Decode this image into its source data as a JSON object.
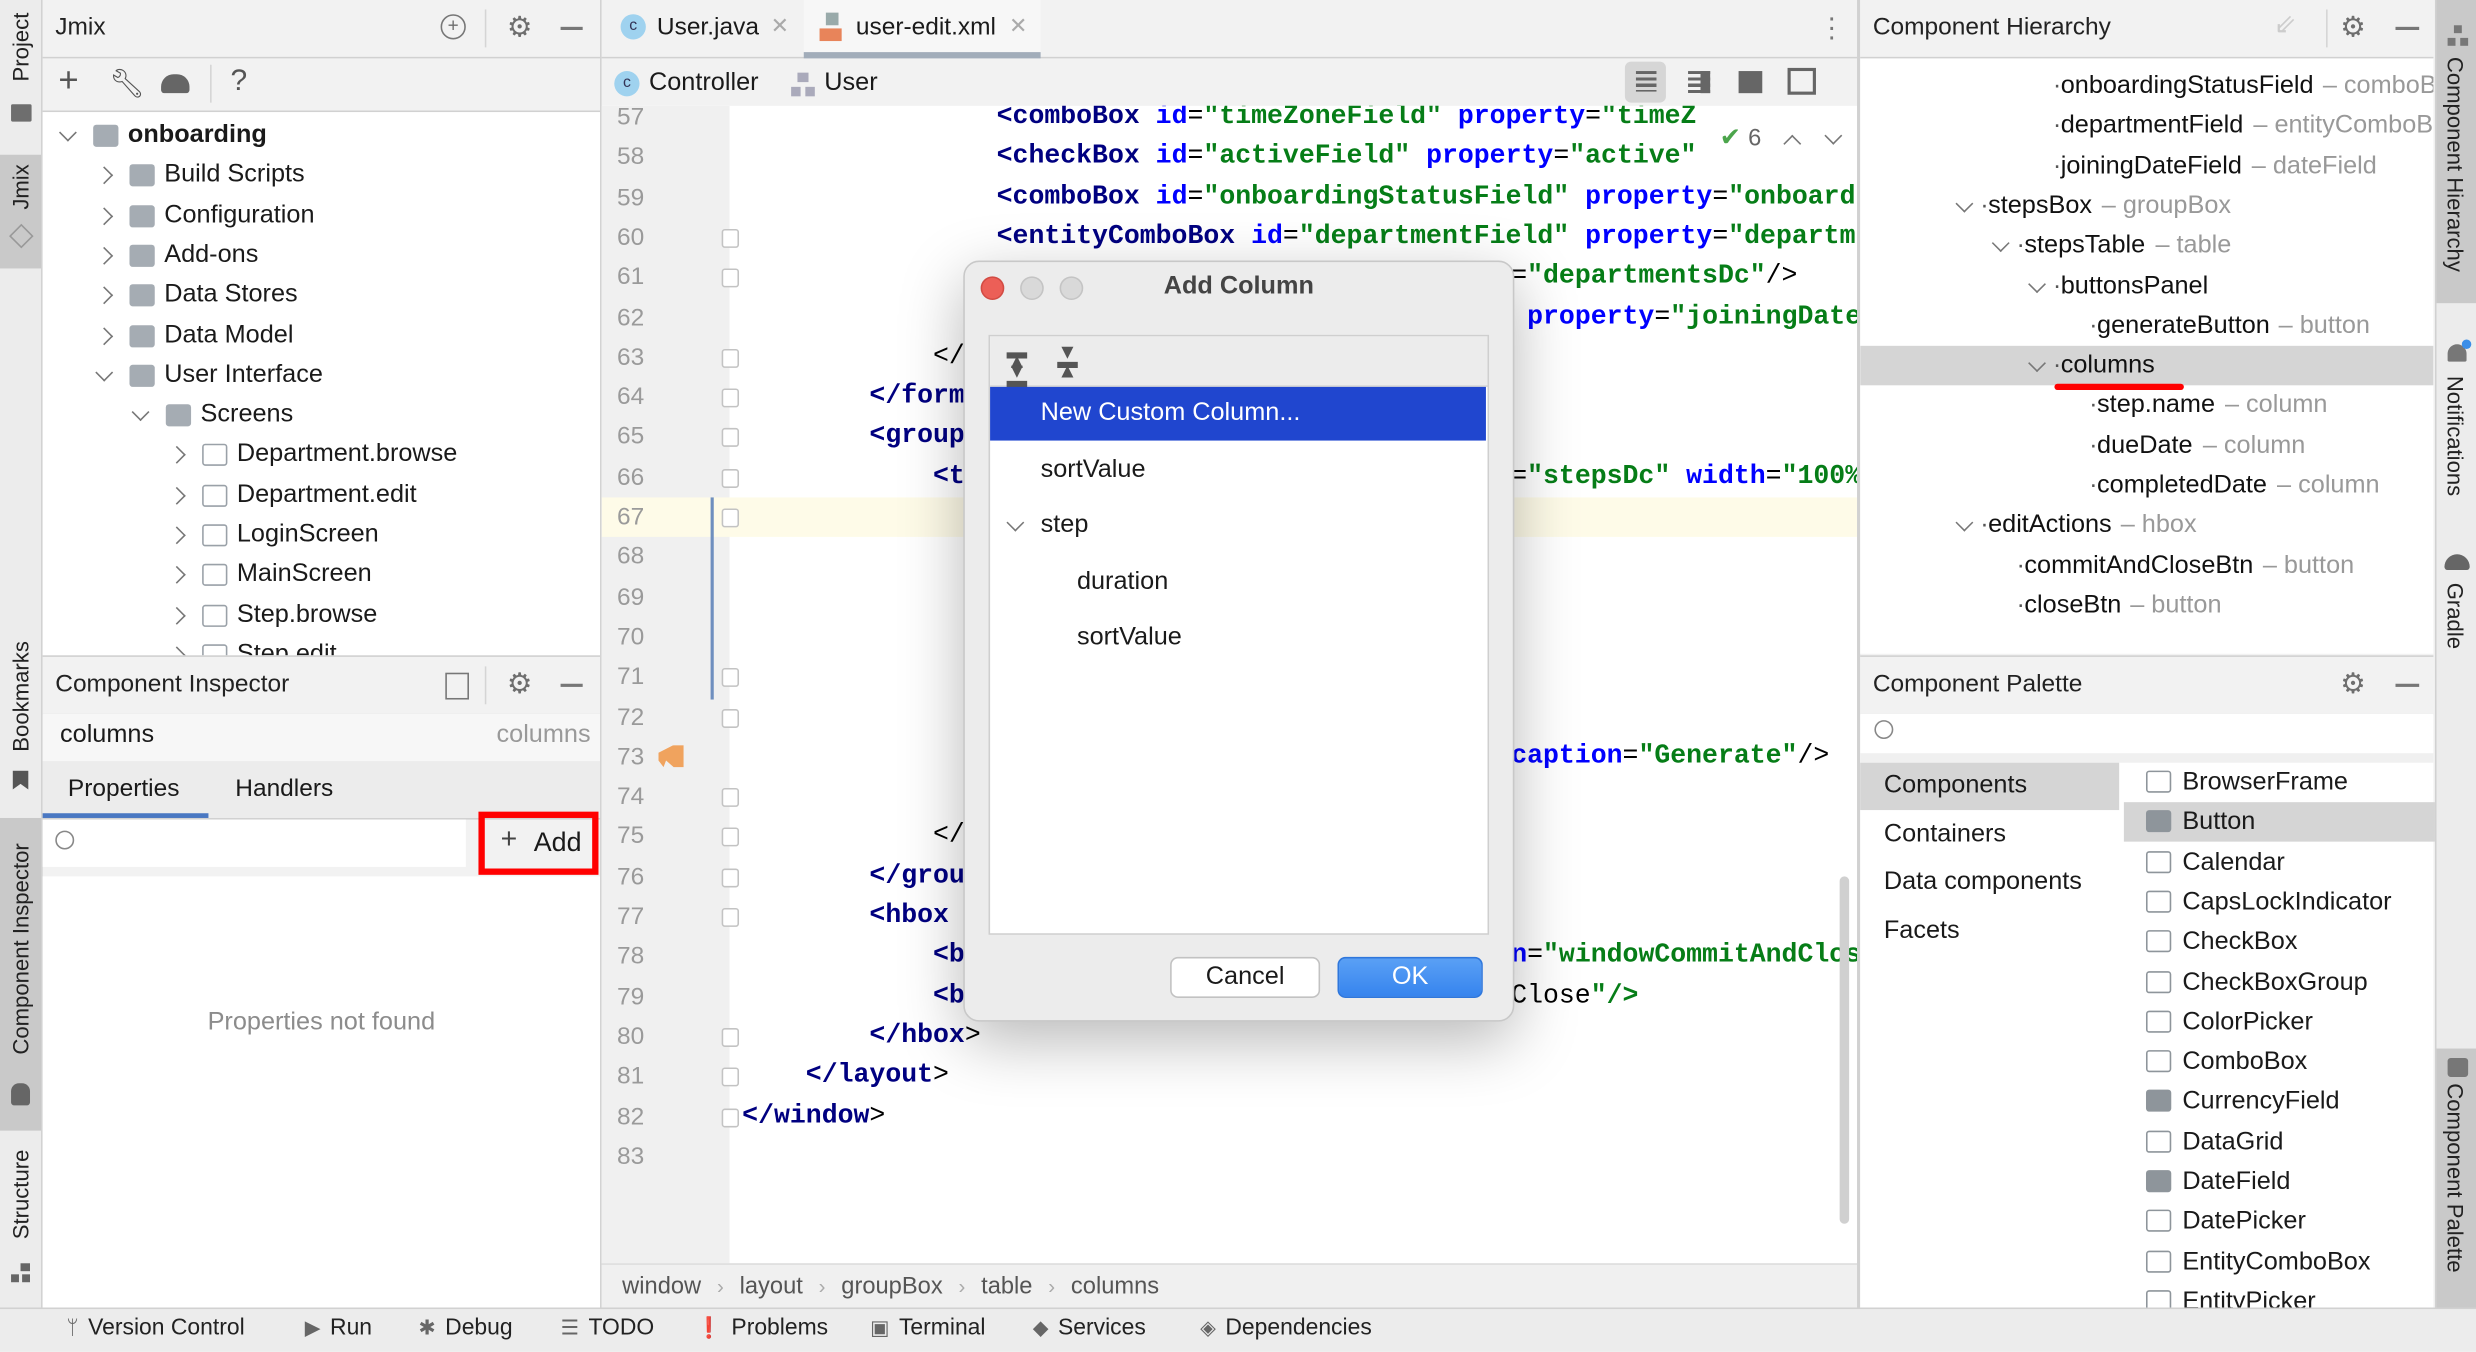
{
  "left_stripe": {
    "tabs": [
      {
        "label": "Project",
        "selected": false
      },
      {
        "label": "Jmix",
        "selected": true
      },
      {
        "label": "Bookmarks",
        "selected": false
      },
      {
        "label": "Component Inspector",
        "selected": true
      },
      {
        "label": "Structure",
        "selected": false
      }
    ]
  },
  "project_panel": {
    "title": "Jmix",
    "toolbar": [
      "add-icon",
      "wrench-icon",
      "gradle-elephant-icon",
      "help-icon"
    ],
    "tree": [
      {
        "label": "onboarding",
        "level": 0,
        "state": "expanded",
        "icon": "jmix-project-icon",
        "bold": true
      },
      {
        "label": "Build Scripts",
        "level": 1,
        "state": "collapsed",
        "icon": "gradle-icon"
      },
      {
        "label": "Configuration",
        "level": 1,
        "state": "collapsed",
        "icon": "config-icon"
      },
      {
        "label": "Add-ons",
        "level": 1,
        "state": "collapsed",
        "icon": "puzzle-icon"
      },
      {
        "label": "Data Stores",
        "level": 1,
        "state": "collapsed",
        "icon": "database-icon"
      },
      {
        "label": "Data Model",
        "level": 1,
        "state": "collapsed",
        "icon": "data-model-icon"
      },
      {
        "label": "User Interface",
        "level": 1,
        "state": "expanded",
        "icon": "window-icon"
      },
      {
        "label": "Screens",
        "level": 2,
        "state": "expanded",
        "icon": "monitor-icon"
      },
      {
        "label": "Department.browse",
        "level": 3,
        "state": "collapsed",
        "icon": "screen-icon"
      },
      {
        "label": "Department.edit",
        "level": 3,
        "state": "collapsed",
        "icon": "screen-icon"
      },
      {
        "label": "LoginScreen",
        "level": 3,
        "state": "collapsed",
        "icon": "screen-icon"
      },
      {
        "label": "MainScreen",
        "level": 3,
        "state": "collapsed",
        "icon": "screen-icon"
      },
      {
        "label": "Step.browse",
        "level": 3,
        "state": "collapsed",
        "icon": "screen-icon"
      },
      {
        "label": "Step.edit",
        "level": 3,
        "state": "collapsed",
        "icon": "screen-icon"
      }
    ]
  },
  "inspector": {
    "title": "Component Inspector",
    "component_name": "columns",
    "component_type": "columns",
    "tabs": [
      {
        "label": "Properties",
        "active": true
      },
      {
        "label": "Handlers",
        "active": false
      }
    ],
    "search_value": "",
    "add_label": "Add",
    "empty_text": "Properties not found"
  },
  "editor": {
    "tabs": [
      {
        "label": "User.java",
        "icon": "java-class-icon",
        "active": false
      },
      {
        "label": "user-edit.xml",
        "icon": "xml-file-icon",
        "active": true
      }
    ],
    "nav": [
      {
        "label": "Controller",
        "icon": "java-class-icon"
      },
      {
        "label": "User",
        "icon": "entity-icon"
      }
    ],
    "inspection_count": "6",
    "lines": [
      {
        "n": "57",
        "text": "                <comboBox id=\"timeZoneField\" property=\"timeZ",
        "right": ""
      },
      {
        "n": "58",
        "text": "                <checkBox id=\"activeField\" property=\"active\"",
        "right": ""
      },
      {
        "n": "59",
        "text": "                <comboBox id=\"onboardingStatusField\" property=\"onboard",
        "right": ""
      },
      {
        "n": "60",
        "text": "                <entityComboBox id=\"departmentField\" property=\"departm",
        "right": ""
      },
      {
        "n": "61",
        "text": "",
        "right": "=\"departmentsDc\"/>"
      },
      {
        "n": "62",
        "text": "",
        "right": " property=\"joiningDate"
      },
      {
        "n": "63",
        "text": "            </",
        "right": ""
      },
      {
        "n": "64",
        "text": "        </form",
        "right": ""
      },
      {
        "n": "65",
        "text": "        <group",
        "right": ""
      },
      {
        "n": "66",
        "text": "            <t",
        "right": "=\"stepsDc\" width=\"100%"
      },
      {
        "n": "67",
        "text": "",
        "right": "",
        "current": true
      },
      {
        "n": "68",
        "text": "",
        "right": ""
      },
      {
        "n": "69",
        "text": "",
        "right": ""
      },
      {
        "n": "70",
        "text": "",
        "right": ""
      },
      {
        "n": "71",
        "text": "",
        "right": ""
      },
      {
        "n": "72",
        "text": "",
        "right": ""
      },
      {
        "n": "73",
        "text": "",
        "right": "caption=\"Generate\"/>"
      },
      {
        "n": "74",
        "text": "",
        "right": ""
      },
      {
        "n": "75",
        "text": "            </",
        "right": ""
      },
      {
        "n": "76",
        "text": "        </grou",
        "right": ""
      },
      {
        "n": "77",
        "text": "        <hbox",
        "right": ""
      },
      {
        "n": "78",
        "text": "            <b",
        "right": "n=\"windowCommitAndClos"
      },
      {
        "n": "79",
        "text": "            <b",
        "right": "Close\"/>"
      },
      {
        "n": "80",
        "text": "        </hbox>",
        "right": ""
      },
      {
        "n": "81",
        "text": "    </layout>",
        "right": ""
      },
      {
        "n": "82",
        "text": "</window>",
        "right": ""
      },
      {
        "n": "83",
        "text": "",
        "right": ""
      }
    ],
    "breadcrumb": [
      "window",
      "layout",
      "groupBox",
      "table",
      "columns"
    ]
  },
  "dialog": {
    "title": "Add Column",
    "toolbar": [
      "expand-all-icon",
      "collapse-all-icon"
    ],
    "items": [
      {
        "label": "New Custom Column...",
        "level": 0,
        "selected": true
      },
      {
        "label": "sortValue",
        "level": 0
      },
      {
        "label": "step",
        "level": 0,
        "expanded": true
      },
      {
        "label": "duration",
        "level": 1
      },
      {
        "label": "sortValue",
        "level": 1
      }
    ],
    "cancel_label": "Cancel",
    "ok_label": "OK"
  },
  "hierarchy": {
    "title": "Component Hierarchy",
    "tree": [
      {
        "name": "onboardingStatusField",
        "type": "comboBox",
        "level": 2
      },
      {
        "name": "departmentField",
        "type": "entityComboBox",
        "level": 2
      },
      {
        "name": "joiningDateField",
        "type": "dateField",
        "level": 2
      },
      {
        "name": "stepsBox",
        "type": "groupBox",
        "level": 0,
        "expanded": true
      },
      {
        "name": "stepsTable",
        "type": "table",
        "level": 1,
        "expanded": true
      },
      {
        "name": "buttonsPanel",
        "type": "",
        "level": 2,
        "expanded": true
      },
      {
        "name": "generateButton",
        "type": "button",
        "level": 3
      },
      {
        "name": "columns",
        "type": "",
        "level": 2,
        "expanded": true,
        "selected": true
      },
      {
        "name": "step.name",
        "type": "column",
        "level": 3
      },
      {
        "name": "dueDate",
        "type": "column",
        "level": 3
      },
      {
        "name": "completedDate",
        "type": "column",
        "level": 3
      },
      {
        "name": "editActions",
        "type": "hbox",
        "level": 0,
        "expanded": true
      },
      {
        "name": "commitAndCloseBtn",
        "type": "button",
        "level": 1
      },
      {
        "name": "closeBtn",
        "type": "button",
        "level": 1
      }
    ]
  },
  "palette": {
    "title": "Component Palette",
    "search_value": "",
    "categories": [
      {
        "label": "Components",
        "selected": true
      },
      {
        "label": "Containers"
      },
      {
        "label": "Data components"
      },
      {
        "label": "Facets"
      }
    ],
    "items": [
      {
        "label": "BrowserFrame"
      },
      {
        "label": "Button",
        "selected": true
      },
      {
        "label": "Calendar"
      },
      {
        "label": "CapsLockIndicator"
      },
      {
        "label": "CheckBox"
      },
      {
        "label": "CheckBoxGroup"
      },
      {
        "label": "ColorPicker"
      },
      {
        "label": "ComboBox"
      },
      {
        "label": "CurrencyField"
      },
      {
        "label": "DataGrid"
      },
      {
        "label": "DateField"
      },
      {
        "label": "DatePicker"
      },
      {
        "label": "EntityComboBox"
      },
      {
        "label": "EntityPicker"
      }
    ]
  },
  "right_stripe": {
    "tabs": [
      {
        "label": "Component Hierarchy",
        "selected": true
      },
      {
        "label": "Notifications"
      },
      {
        "label": "Gradle"
      },
      {
        "label": "Component Palette",
        "selected": true
      }
    ]
  },
  "bottom_bar": {
    "items": [
      {
        "label": "Version Control",
        "icon": "branch-icon"
      },
      {
        "label": "Run",
        "icon": "run-icon"
      },
      {
        "label": "Debug",
        "icon": "bug-icon"
      },
      {
        "label": "TODO",
        "icon": "list-icon"
      },
      {
        "label": "Problems",
        "icon": "warning-icon"
      },
      {
        "label": "Terminal",
        "icon": "terminal-icon"
      },
      {
        "label": "Services",
        "icon": "services-icon"
      },
      {
        "label": "Dependencies",
        "icon": "dependencies-icon"
      }
    ]
  },
  "colors": {
    "selection_blue": "#2046cf",
    "ok_button": "#3d8bf0",
    "highlight_red": "#ff0000",
    "current_line": "#fefbe8",
    "tag": "#000080",
    "attribute": "#0000ff",
    "value": "#067d17"
  }
}
